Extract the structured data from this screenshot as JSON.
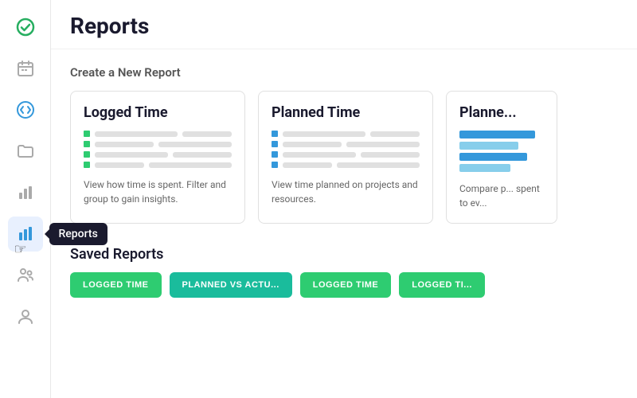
{
  "sidebar": {
    "items": [
      {
        "id": "check",
        "icon": "check-circle",
        "active": false
      },
      {
        "id": "calendar",
        "icon": "calendar",
        "active": false
      },
      {
        "id": "arrows",
        "icon": "double-arrow",
        "active": false
      },
      {
        "id": "folder",
        "icon": "folder",
        "active": false
      },
      {
        "id": "bar-chart-small",
        "icon": "bar-chart-small",
        "active": false
      },
      {
        "id": "reports",
        "icon": "bar-chart",
        "active": true,
        "tooltip": "Reports"
      },
      {
        "id": "team",
        "icon": "team",
        "active": false
      },
      {
        "id": "person",
        "icon": "person",
        "active": false
      }
    ]
  },
  "page": {
    "title": "Reports"
  },
  "create_section": {
    "title": "Create a New Report",
    "cards": [
      {
        "id": "logged-time",
        "title": "Logged Time",
        "description": "View how time is spent. Filter and group to gain insights.",
        "dot_color": "#2ecc71"
      },
      {
        "id": "planned-time",
        "title": "Planned Time",
        "description": "View time planned on projects and resources.",
        "dot_color": "#3498db"
      },
      {
        "id": "planned-vs-actual",
        "title": "Planne...",
        "description": "Compare p... spent to ev...",
        "dot_color": "#3498db",
        "partial": true
      }
    ]
  },
  "saved_section": {
    "title": "Saved Reports",
    "buttons": [
      {
        "label": "LOGGED TIME",
        "style": "green"
      },
      {
        "label": "PLANNED VS ACTU...",
        "style": "teal"
      },
      {
        "label": "LOGGED TIME",
        "style": "green"
      },
      {
        "label": "LOGGED TI...",
        "style": "green"
      }
    ]
  }
}
